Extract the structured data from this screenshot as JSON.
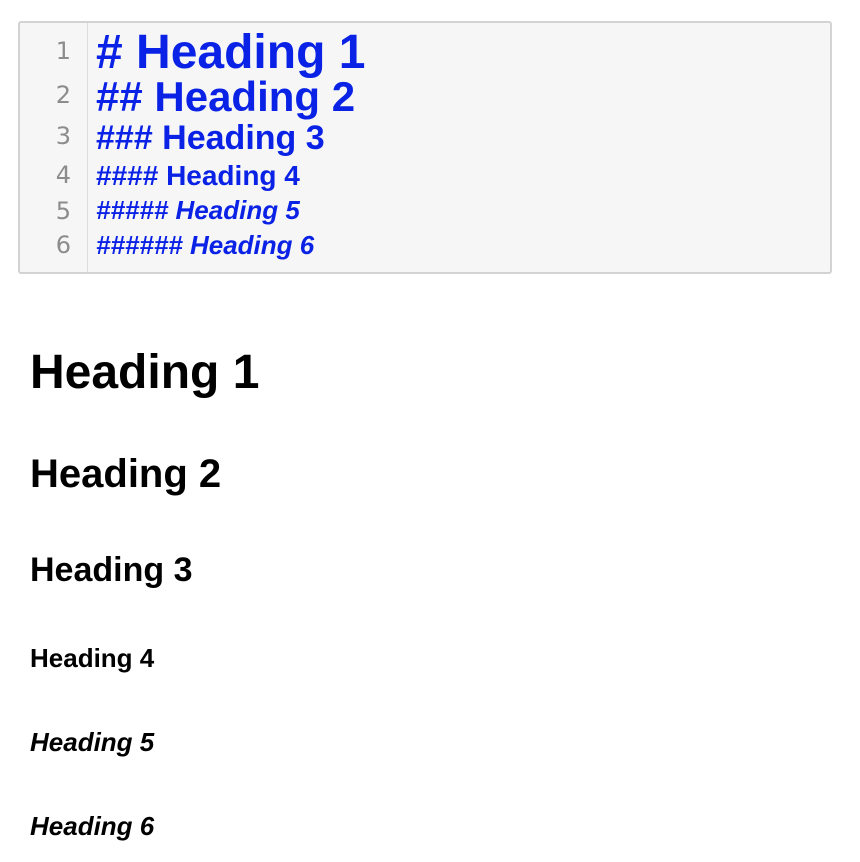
{
  "editor": {
    "line_numbers": [
      "1",
      "2",
      "3",
      "4",
      "5",
      "6"
    ],
    "lines": [
      "# Heading 1",
      "## Heading 2",
      "### Heading 3",
      "#### Heading 4",
      "##### Heading 5",
      "###### Heading 6"
    ],
    "colors": {
      "syntax_heading": "#0a22e6",
      "line_number": "#8c8c8c",
      "background": "#f6f6f6",
      "border": "#d3d3d3"
    }
  },
  "preview": {
    "headings": [
      "Heading 1",
      "Heading 2",
      "Heading 3",
      "Heading 4",
      "Heading 5",
      "Heading 6"
    ]
  }
}
